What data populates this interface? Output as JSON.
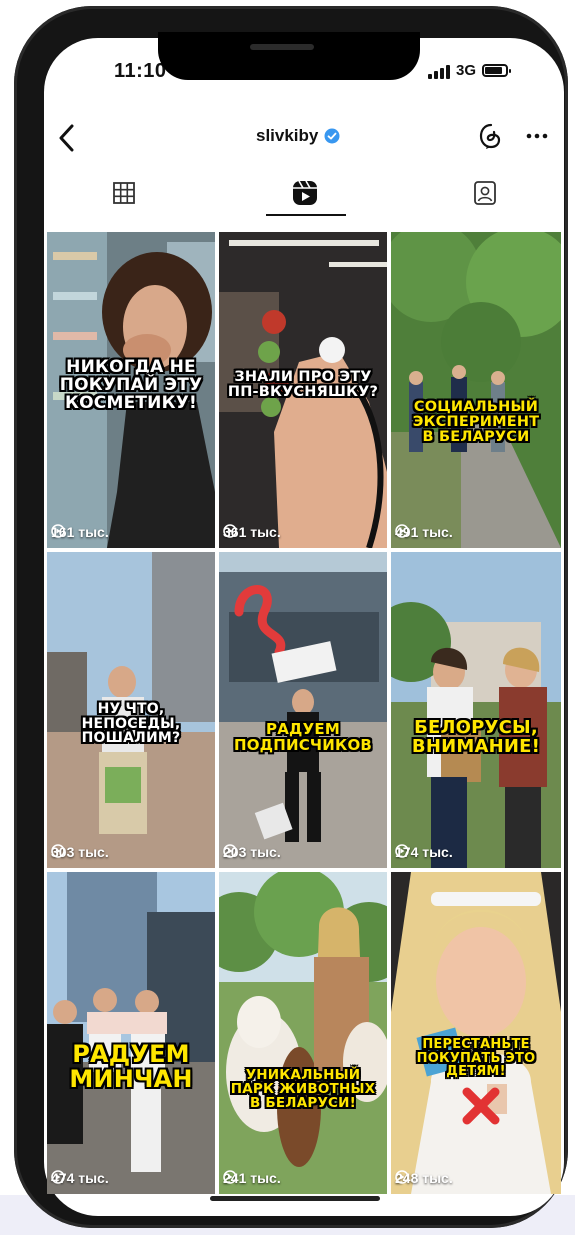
{
  "status": {
    "time": "11:10",
    "network": "3G"
  },
  "header": {
    "username": "slivkiby",
    "back_icon": "chevron-left-icon",
    "threads_icon": "threads-icon",
    "more_icon": "more-dots-icon"
  },
  "tabs": [
    {
      "name": "grid",
      "icon": "grid-icon"
    },
    {
      "name": "reels",
      "icon": "reels-icon",
      "active": true
    },
    {
      "name": "tagged",
      "icon": "tagged-person-icon"
    }
  ],
  "posts": [
    {
      "caption_lines": [
        "НИКОГДА НЕ",
        "ПОКУПАЙ ЭТУ",
        "КОСМЕТИКУ!"
      ],
      "caption_color": "white",
      "views": "161 тыс."
    },
    {
      "caption_lines": [
        "ЗНАЛИ ПРО ЭТУ",
        "ПП-ВКУСНЯШКУ?"
      ],
      "caption_color": "white",
      "views": "361 тыс."
    },
    {
      "caption_lines": [
        "СОЦИАЛЬНЫЙ",
        "ЭКСПЕРИМЕНТ",
        "В БЕЛАРУСИ"
      ],
      "caption_color": "yellow",
      "views": "491 тыс."
    },
    {
      "caption_lines": [
        "НУ ЧТО,",
        "НЕПОСЕДЫ,",
        "ПОШАЛИМ?"
      ],
      "caption_color": "white",
      "views": "303 тыс."
    },
    {
      "caption_lines": [
        "РАДУЕМ",
        "ПОДПИСЧИКОВ"
      ],
      "caption_color": "yellow",
      "views": "203 тыс."
    },
    {
      "caption_lines": [
        "БЕЛОРУСЫ,",
        "ВНИМАНИЕ!"
      ],
      "caption_color": "yellow",
      "views": "174 тыс."
    },
    {
      "caption_lines": [
        "РАДУЕМ",
        "МИНЧАН"
      ],
      "caption_color": "yellow",
      "views": "474 тыс."
    },
    {
      "caption_lines": [
        "УНИКАЛЬНЫЙ",
        "ПАРК ЖИВОТНЫХ",
        "В БЕЛАРУСИ!"
      ],
      "caption_color": "yellow",
      "views": "241 тыс."
    },
    {
      "caption_lines": [
        "ПЕРЕСТАНЬТЕ",
        "ПОКУПАТЬ ЭТО",
        "ДЕТЯМ!"
      ],
      "caption_color": "yellow",
      "views": "248 тыс."
    }
  ],
  "colors": {
    "verified": "#3897f0",
    "caption_yellow": "#ffe600",
    "text": "#111111"
  }
}
